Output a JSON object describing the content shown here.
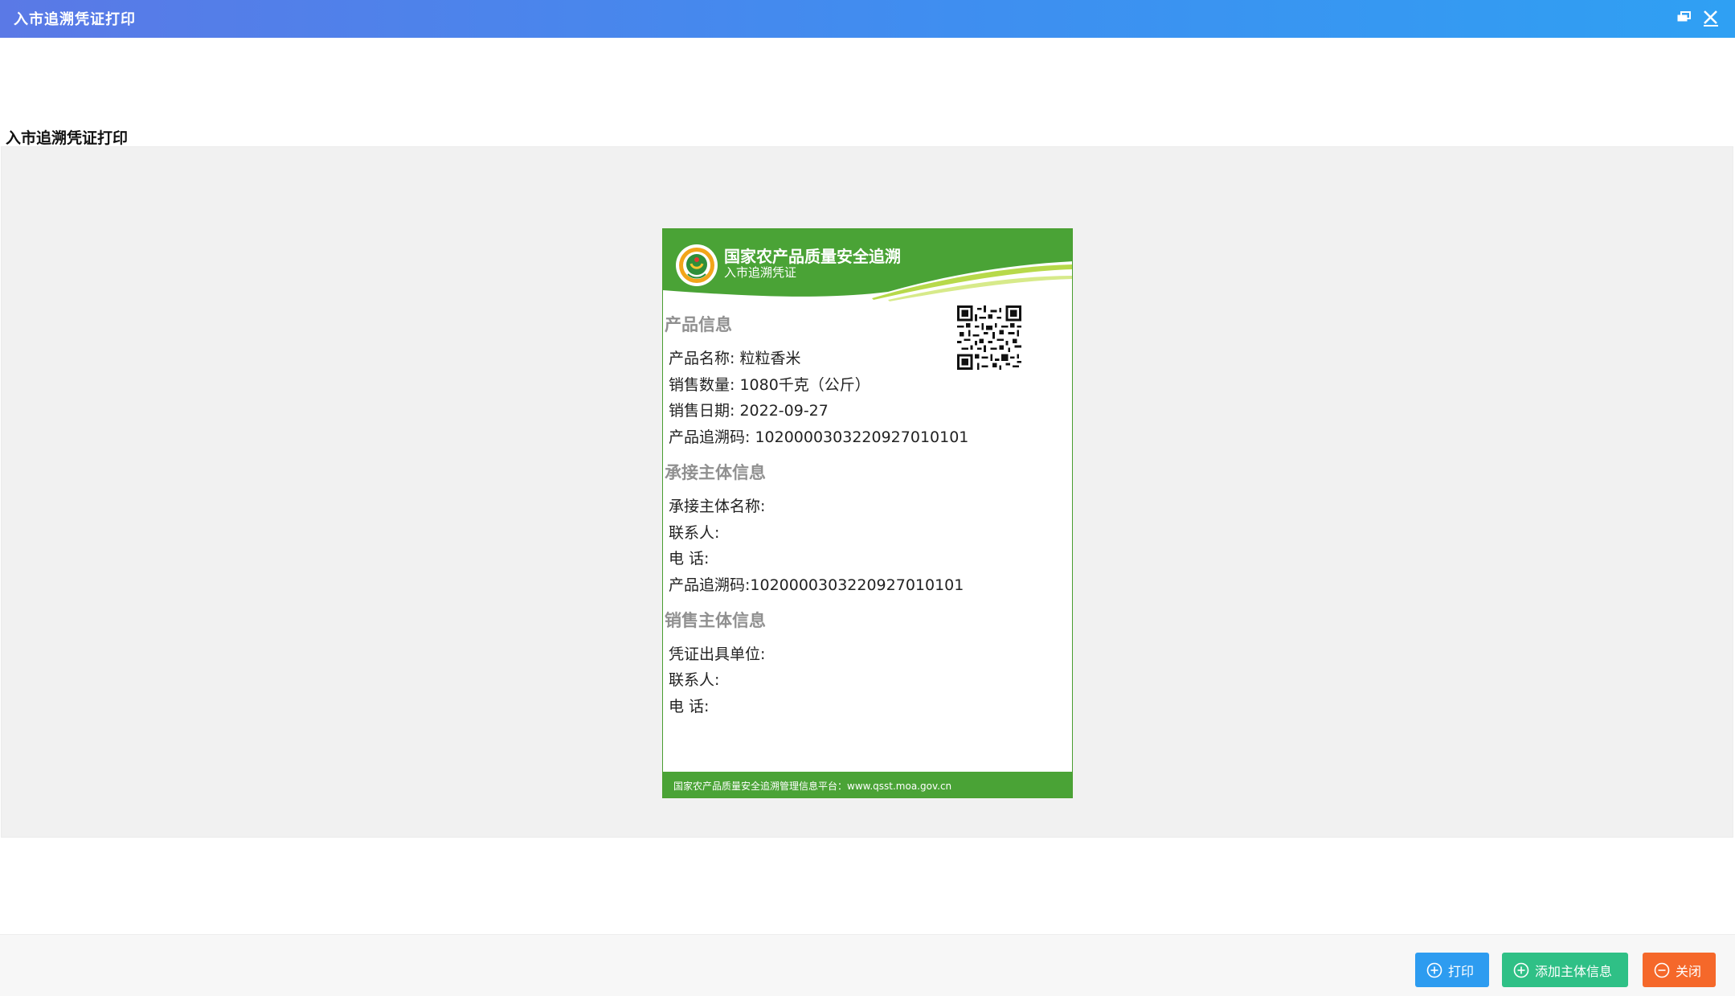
{
  "window": {
    "title": "入市追溯凭证打印",
    "restore_icon": "restore-icon",
    "close_icon": "close-icon"
  },
  "section_title": "入市追溯凭证打印",
  "certificate": {
    "org_title": "国家农产品质量安全追溯",
    "subtitle": "入市追溯凭证",
    "product_heading": "产品信息",
    "product_lines": [
      "产品名称: 粒粒香米",
      "销售数量: 1080千克（公斤）",
      "销售日期: 2022-09-27",
      "产品追溯码: 102000030322092701010​1"
    ],
    "receiver_heading": "承接主体信息",
    "receiver_lines": [
      "承接主体名称:",
      "联系人:",
      "电 话:",
      "产品追溯码:102000030322092701010​1"
    ],
    "seller_heading": "销售主体信息",
    "seller_lines": [
      "凭证出具单位:",
      "联系人:",
      "电 话:"
    ],
    "footer": "国家农产品质量安全追溯管理信息平台：www.qsst.moa.gov.cn",
    "colors": {
      "green": "#4aa336",
      "light_green": "#b7d94a"
    }
  },
  "buttons": {
    "print": "打印",
    "add_subject": "添加主体信息",
    "close": "关闭"
  },
  "colors": {
    "print": "#2d9cf0",
    "add_subject": "#2fc086",
    "close": "#f5682a"
  }
}
